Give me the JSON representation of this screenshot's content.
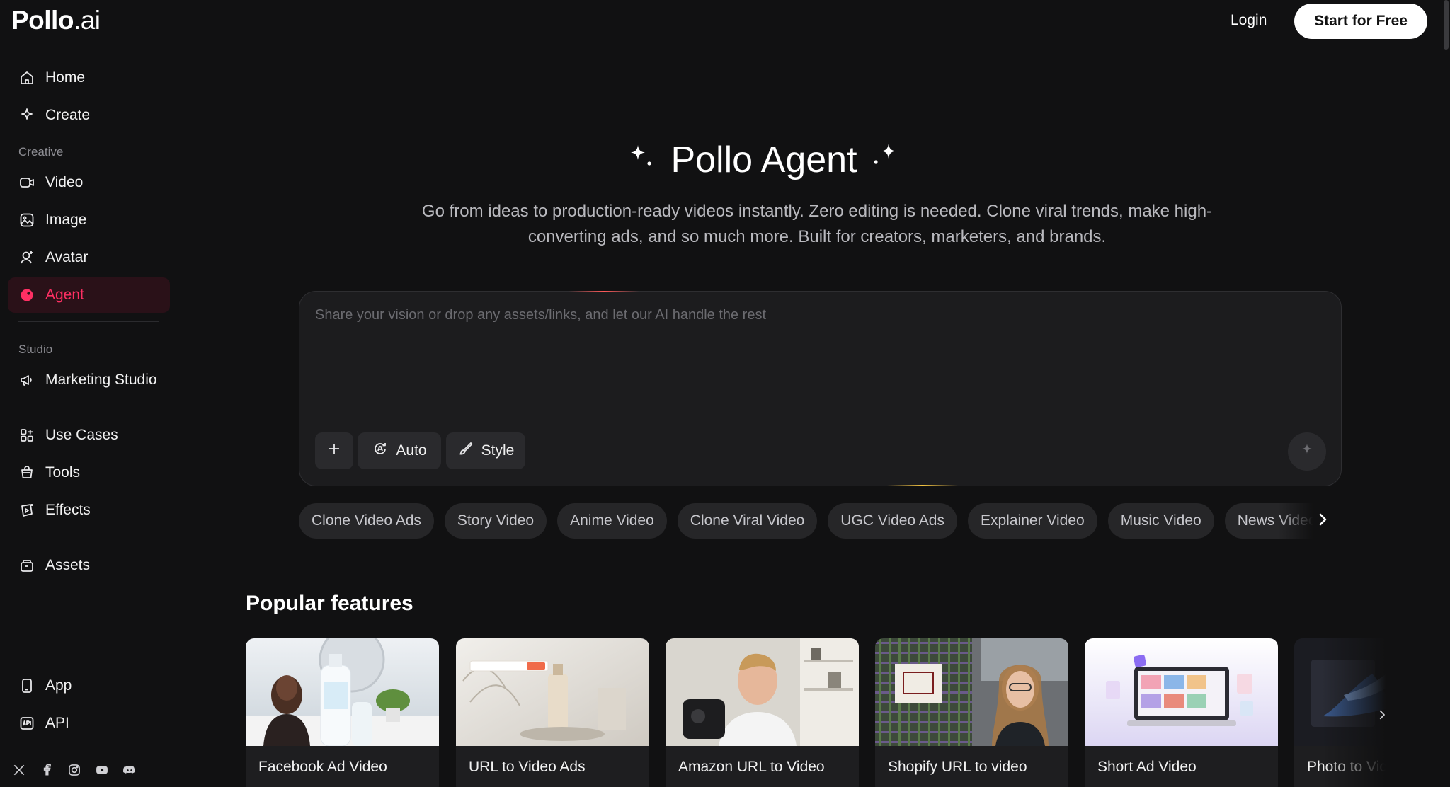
{
  "brand": {
    "name": "Pollo",
    "suffix": ".ai"
  },
  "header": {
    "login_label": "Login",
    "start_label": "Start for Free"
  },
  "sidebar": {
    "items_top": [
      {
        "label": "Home",
        "icon": "home-icon"
      },
      {
        "label": "Create",
        "icon": "sparkle-icon"
      }
    ],
    "creative_label": "Creative",
    "creative_items": [
      {
        "label": "Video",
        "icon": "video-icon"
      },
      {
        "label": "Image",
        "icon": "image-icon"
      },
      {
        "label": "Avatar",
        "icon": "avatar-icon"
      },
      {
        "label": "Agent",
        "icon": "agent-icon",
        "active": true
      }
    ],
    "studio_label": "Studio",
    "studio_items": [
      {
        "label": "Marketing Studio",
        "icon": "megaphone-icon"
      }
    ],
    "more_items": [
      {
        "label": "Use Cases",
        "icon": "grid-icon"
      },
      {
        "label": "Tools",
        "icon": "toolbox-icon"
      },
      {
        "label": "Effects",
        "icon": "effects-icon"
      }
    ],
    "assets_item": {
      "label": "Assets",
      "icon": "folder-icon"
    },
    "bottom_items": [
      {
        "label": "App",
        "icon": "phone-icon"
      },
      {
        "label": "API",
        "icon": "api-icon"
      }
    ],
    "socials": [
      "x-icon",
      "facebook-icon",
      "instagram-icon",
      "youtube-icon",
      "discord-icon"
    ]
  },
  "hero": {
    "title": "Pollo Agent",
    "subtitle": "Go from ideas to production-ready videos instantly. Zero editing is needed. Clone viral trends, make high-converting ads, and so much more. Built for creators, marketers, and brands."
  },
  "prompt": {
    "placeholder": "Share your vision or drop any assets/links, and let our AI handle the rest",
    "value": "",
    "auto_label": "Auto",
    "style_label": "Style"
  },
  "chips": [
    "Clone Video Ads",
    "Story Video",
    "Anime Video",
    "Clone Viral Video",
    "UGC Video Ads",
    "Explainer Video",
    "Music Video",
    "News Video"
  ],
  "popular": {
    "title": "Popular features",
    "cards": [
      {
        "label": "Facebook Ad Video",
        "thumb": "skincare-product-with-woman"
      },
      {
        "label": "URL to Video Ads",
        "thumb": "bottle-on-stone"
      },
      {
        "label": "Amazon URL to Video",
        "thumb": "man-holding-product"
      },
      {
        "label": "Shopify URL to video",
        "thumb": "fabric-and-woman-in-car"
      },
      {
        "label": "Short Ad Video",
        "thumb": "laptop-with-photos"
      },
      {
        "label": "Photo to Video",
        "thumb": "dark-product-render"
      }
    ]
  },
  "colors": {
    "background": "#111112",
    "accent": "#ff2f63",
    "surface": "#1c1c1e"
  }
}
